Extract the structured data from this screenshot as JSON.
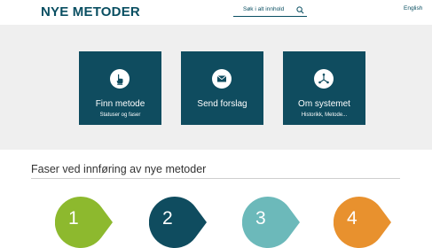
{
  "header": {
    "logo": "NYE METODER",
    "search_placeholder": "Søk i alt innhold",
    "language_link": "English"
  },
  "tiles": [
    {
      "title": "Finn metode",
      "subtitle": "Statuser og faser",
      "icon": "hand-pointer-icon"
    },
    {
      "title": "Send forslag",
      "subtitle": "",
      "icon": "envelope-icon"
    },
    {
      "title": "Om systemet",
      "subtitle": "Historikk, Metode...",
      "icon": "connection-icon"
    }
  ],
  "phases_section": {
    "title": "Faser ved innføring av nye metoder",
    "phases": [
      {
        "number": "1",
        "color": "#8db92e"
      },
      {
        "number": "2",
        "color": "#0f4c5f"
      },
      {
        "number": "3",
        "color": "#6cb9ba"
      },
      {
        "number": "4",
        "color": "#e8912e"
      }
    ]
  },
  "colors": {
    "brand": "#0a4f62",
    "tile_bg": "#0f4c5f",
    "band_bg": "#efefef"
  }
}
